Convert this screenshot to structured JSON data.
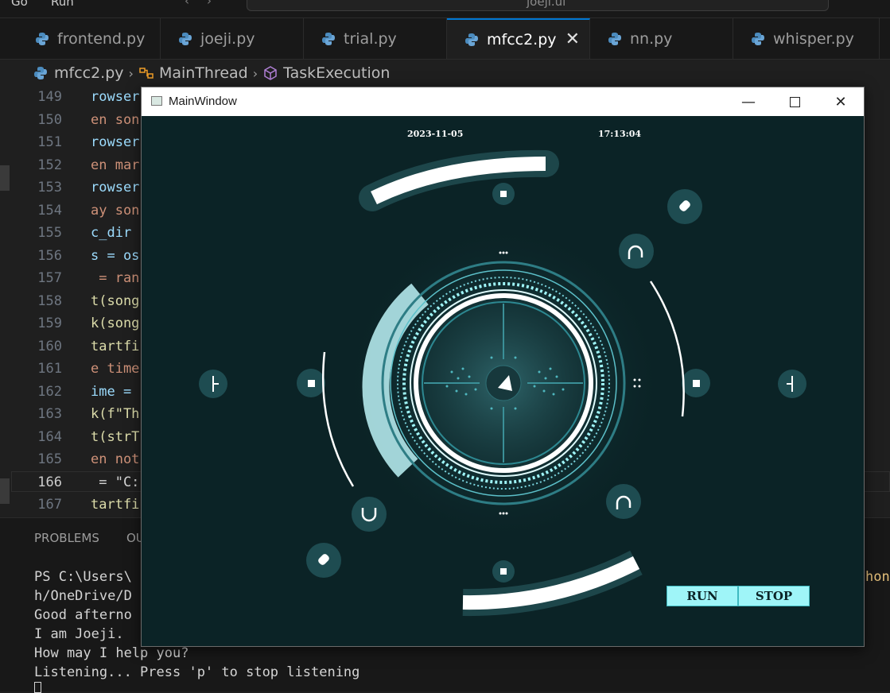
{
  "menubar": {
    "go": "Go",
    "run": "Run",
    "command_center": "joeji.ui"
  },
  "tabs": [
    {
      "label": "frontend.py"
    },
    {
      "label": "joeji.py"
    },
    {
      "label": "trial.py"
    },
    {
      "label": "mfcc2.py",
      "active": true
    },
    {
      "label": "nn.py"
    },
    {
      "label": "whisper.py"
    }
  ],
  "breadcrumb": {
    "file": "mfcc2.py",
    "class": "MainThread",
    "method": "TaskExecution"
  },
  "editor": {
    "current_line": "166",
    "lines": [
      {
        "num": "149",
        "text": "rowser",
        "color": "blue"
      },
      {
        "num": "150",
        "text": "en son",
        "color": "orange"
      },
      {
        "num": "151",
        "text": "rowser",
        "color": "blue"
      },
      {
        "num": "152",
        "text": "en mar",
        "color": "orange"
      },
      {
        "num": "153",
        "text": "rowser",
        "color": "blue"
      },
      {
        "num": "154",
        "text": "ay son",
        "color": "orange"
      },
      {
        "num": "155",
        "text": "c_dir ",
        "color": "blue"
      },
      {
        "num": "156",
        "text": "s = os",
        "color": "blue"
      },
      {
        "num": "157",
        "text": " = ran",
        "color": "orange"
      },
      {
        "num": "158",
        "text": "t(song",
        "color": "yellow"
      },
      {
        "num": "159",
        "text": "k(song",
        "color": "yellow"
      },
      {
        "num": "160",
        "text": "tartfi",
        "color": "yellow"
      },
      {
        "num": "161",
        "text": "e time",
        "color": "orange"
      },
      {
        "num": "162",
        "text": "ime = ",
        "color": "blue"
      },
      {
        "num": "163",
        "text": "k(f\"Th",
        "color": "yellow"
      },
      {
        "num": "164",
        "text": "t(strT",
        "color": "yellow"
      },
      {
        "num": "165",
        "text": "en not",
        "color": "orange"
      },
      {
        "num": "166",
        "text": " = \"C:",
        "color": "white"
      },
      {
        "num": "167",
        "text": "tartfi",
        "color": "yellow"
      }
    ]
  },
  "panel": {
    "tabs": [
      "PROBLEMS",
      "OU"
    ],
    "terminal": [
      "PS C:\\Users\\",
      "h/OneDrive/D",
      "Good afterno",
      "I am Joeji.",
      "How may I help you?",
      "Listening... Press 'p' to stop listening"
    ],
    "right_fragment": "hon"
  },
  "window": {
    "title": "MainWindow",
    "date": "2023-11-05",
    "time": "17:13:04",
    "run_label": "RUN",
    "stop_label": "STOP",
    "hud_bg": "#0b2326",
    "hud_accent": "#9ff5f8"
  },
  "icons": [
    "python-file-icon",
    "class-icon",
    "method-icon",
    "window-app-icon",
    "minimize-icon",
    "maximize-icon",
    "close-icon"
  ]
}
